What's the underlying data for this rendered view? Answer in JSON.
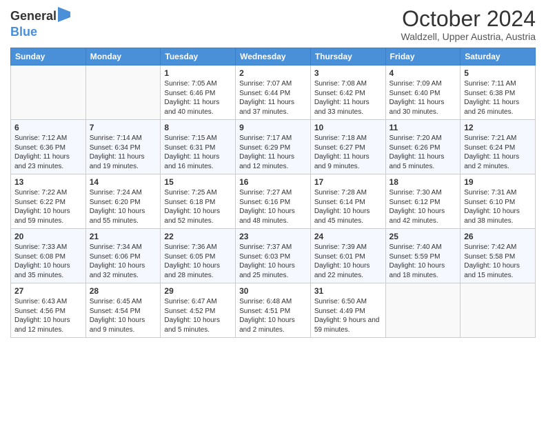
{
  "header": {
    "logo_line1": "General",
    "logo_line2": "Blue",
    "title": "October 2024",
    "subtitle": "Waldzell, Upper Austria, Austria"
  },
  "days_of_week": [
    "Sunday",
    "Monday",
    "Tuesday",
    "Wednesday",
    "Thursday",
    "Friday",
    "Saturday"
  ],
  "weeks": [
    [
      {
        "day": "",
        "sunrise": "",
        "sunset": "",
        "daylight": ""
      },
      {
        "day": "",
        "sunrise": "",
        "sunset": "",
        "daylight": ""
      },
      {
        "day": "1",
        "sunrise": "Sunrise: 7:05 AM",
        "sunset": "Sunset: 6:46 PM",
        "daylight": "Daylight: 11 hours and 40 minutes."
      },
      {
        "day": "2",
        "sunrise": "Sunrise: 7:07 AM",
        "sunset": "Sunset: 6:44 PM",
        "daylight": "Daylight: 11 hours and 37 minutes."
      },
      {
        "day": "3",
        "sunrise": "Sunrise: 7:08 AM",
        "sunset": "Sunset: 6:42 PM",
        "daylight": "Daylight: 11 hours and 33 minutes."
      },
      {
        "day": "4",
        "sunrise": "Sunrise: 7:09 AM",
        "sunset": "Sunset: 6:40 PM",
        "daylight": "Daylight: 11 hours and 30 minutes."
      },
      {
        "day": "5",
        "sunrise": "Sunrise: 7:11 AM",
        "sunset": "Sunset: 6:38 PM",
        "daylight": "Daylight: 11 hours and 26 minutes."
      }
    ],
    [
      {
        "day": "6",
        "sunrise": "Sunrise: 7:12 AM",
        "sunset": "Sunset: 6:36 PM",
        "daylight": "Daylight: 11 hours and 23 minutes."
      },
      {
        "day": "7",
        "sunrise": "Sunrise: 7:14 AM",
        "sunset": "Sunset: 6:34 PM",
        "daylight": "Daylight: 11 hours and 19 minutes."
      },
      {
        "day": "8",
        "sunrise": "Sunrise: 7:15 AM",
        "sunset": "Sunset: 6:31 PM",
        "daylight": "Daylight: 11 hours and 16 minutes."
      },
      {
        "day": "9",
        "sunrise": "Sunrise: 7:17 AM",
        "sunset": "Sunset: 6:29 PM",
        "daylight": "Daylight: 11 hours and 12 minutes."
      },
      {
        "day": "10",
        "sunrise": "Sunrise: 7:18 AM",
        "sunset": "Sunset: 6:27 PM",
        "daylight": "Daylight: 11 hours and 9 minutes."
      },
      {
        "day": "11",
        "sunrise": "Sunrise: 7:20 AM",
        "sunset": "Sunset: 6:26 PM",
        "daylight": "Daylight: 11 hours and 5 minutes."
      },
      {
        "day": "12",
        "sunrise": "Sunrise: 7:21 AM",
        "sunset": "Sunset: 6:24 PM",
        "daylight": "Daylight: 11 hours and 2 minutes."
      }
    ],
    [
      {
        "day": "13",
        "sunrise": "Sunrise: 7:22 AM",
        "sunset": "Sunset: 6:22 PM",
        "daylight": "Daylight: 10 hours and 59 minutes."
      },
      {
        "day": "14",
        "sunrise": "Sunrise: 7:24 AM",
        "sunset": "Sunset: 6:20 PM",
        "daylight": "Daylight: 10 hours and 55 minutes."
      },
      {
        "day": "15",
        "sunrise": "Sunrise: 7:25 AM",
        "sunset": "Sunset: 6:18 PM",
        "daylight": "Daylight: 10 hours and 52 minutes."
      },
      {
        "day": "16",
        "sunrise": "Sunrise: 7:27 AM",
        "sunset": "Sunset: 6:16 PM",
        "daylight": "Daylight: 10 hours and 48 minutes."
      },
      {
        "day": "17",
        "sunrise": "Sunrise: 7:28 AM",
        "sunset": "Sunset: 6:14 PM",
        "daylight": "Daylight: 10 hours and 45 minutes."
      },
      {
        "day": "18",
        "sunrise": "Sunrise: 7:30 AM",
        "sunset": "Sunset: 6:12 PM",
        "daylight": "Daylight: 10 hours and 42 minutes."
      },
      {
        "day": "19",
        "sunrise": "Sunrise: 7:31 AM",
        "sunset": "Sunset: 6:10 PM",
        "daylight": "Daylight: 10 hours and 38 minutes."
      }
    ],
    [
      {
        "day": "20",
        "sunrise": "Sunrise: 7:33 AM",
        "sunset": "Sunset: 6:08 PM",
        "daylight": "Daylight: 10 hours and 35 minutes."
      },
      {
        "day": "21",
        "sunrise": "Sunrise: 7:34 AM",
        "sunset": "Sunset: 6:06 PM",
        "daylight": "Daylight: 10 hours and 32 minutes."
      },
      {
        "day": "22",
        "sunrise": "Sunrise: 7:36 AM",
        "sunset": "Sunset: 6:05 PM",
        "daylight": "Daylight: 10 hours and 28 minutes."
      },
      {
        "day": "23",
        "sunrise": "Sunrise: 7:37 AM",
        "sunset": "Sunset: 6:03 PM",
        "daylight": "Daylight: 10 hours and 25 minutes."
      },
      {
        "day": "24",
        "sunrise": "Sunrise: 7:39 AM",
        "sunset": "Sunset: 6:01 PM",
        "daylight": "Daylight: 10 hours and 22 minutes."
      },
      {
        "day": "25",
        "sunrise": "Sunrise: 7:40 AM",
        "sunset": "Sunset: 5:59 PM",
        "daylight": "Daylight: 10 hours and 18 minutes."
      },
      {
        "day": "26",
        "sunrise": "Sunrise: 7:42 AM",
        "sunset": "Sunset: 5:58 PM",
        "daylight": "Daylight: 10 hours and 15 minutes."
      }
    ],
    [
      {
        "day": "27",
        "sunrise": "Sunrise: 6:43 AM",
        "sunset": "Sunset: 4:56 PM",
        "daylight": "Daylight: 10 hours and 12 minutes."
      },
      {
        "day": "28",
        "sunrise": "Sunrise: 6:45 AM",
        "sunset": "Sunset: 4:54 PM",
        "daylight": "Daylight: 10 hours and 9 minutes."
      },
      {
        "day": "29",
        "sunrise": "Sunrise: 6:47 AM",
        "sunset": "Sunset: 4:52 PM",
        "daylight": "Daylight: 10 hours and 5 minutes."
      },
      {
        "day": "30",
        "sunrise": "Sunrise: 6:48 AM",
        "sunset": "Sunset: 4:51 PM",
        "daylight": "Daylight: 10 hours and 2 minutes."
      },
      {
        "day": "31",
        "sunrise": "Sunrise: 6:50 AM",
        "sunset": "Sunset: 4:49 PM",
        "daylight": "Daylight: 9 hours and 59 minutes."
      },
      {
        "day": "",
        "sunrise": "",
        "sunset": "",
        "daylight": ""
      },
      {
        "day": "",
        "sunrise": "",
        "sunset": "",
        "daylight": ""
      }
    ]
  ]
}
